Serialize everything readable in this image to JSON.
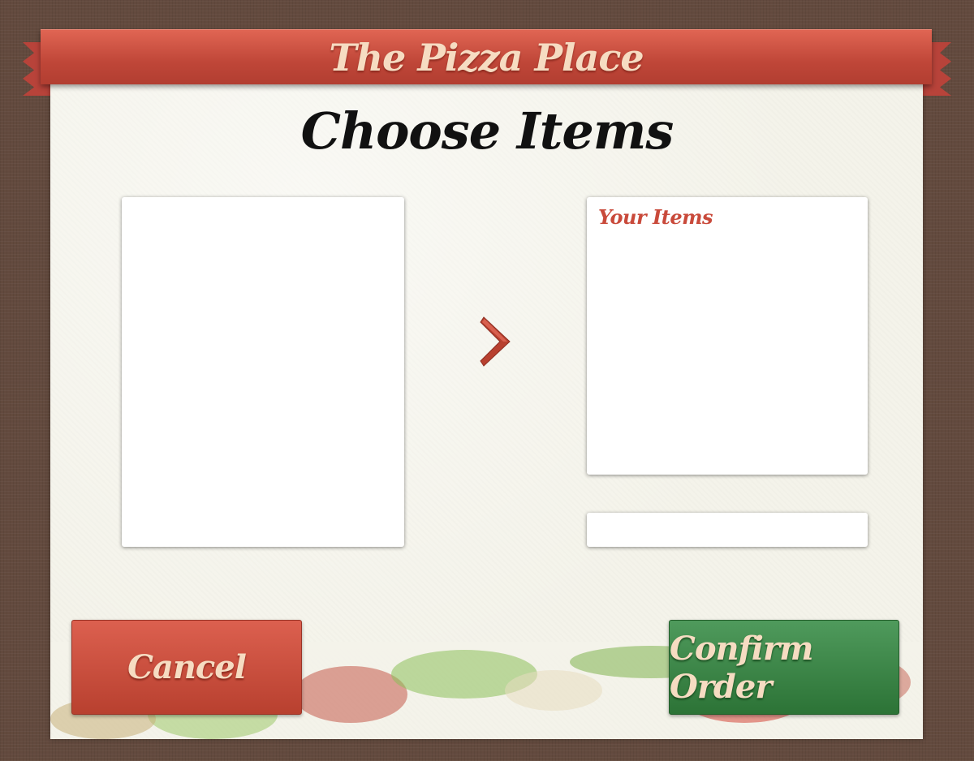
{
  "app": {
    "title": "The Pizza Place"
  },
  "page": {
    "title": "Choose Items"
  },
  "selected_list": {
    "heading": "Your Items"
  },
  "actions": {
    "add_icon": "chevron-right-icon",
    "cancel_label": "Cancel",
    "confirm_label": "Confirm Order"
  },
  "colors": {
    "background": "#634a3e",
    "banner": "#c94a3b",
    "card": "#f4f3ea",
    "cancel": "#c94a3b",
    "confirm": "#3d8848",
    "title_text": "#f6dcc2"
  }
}
